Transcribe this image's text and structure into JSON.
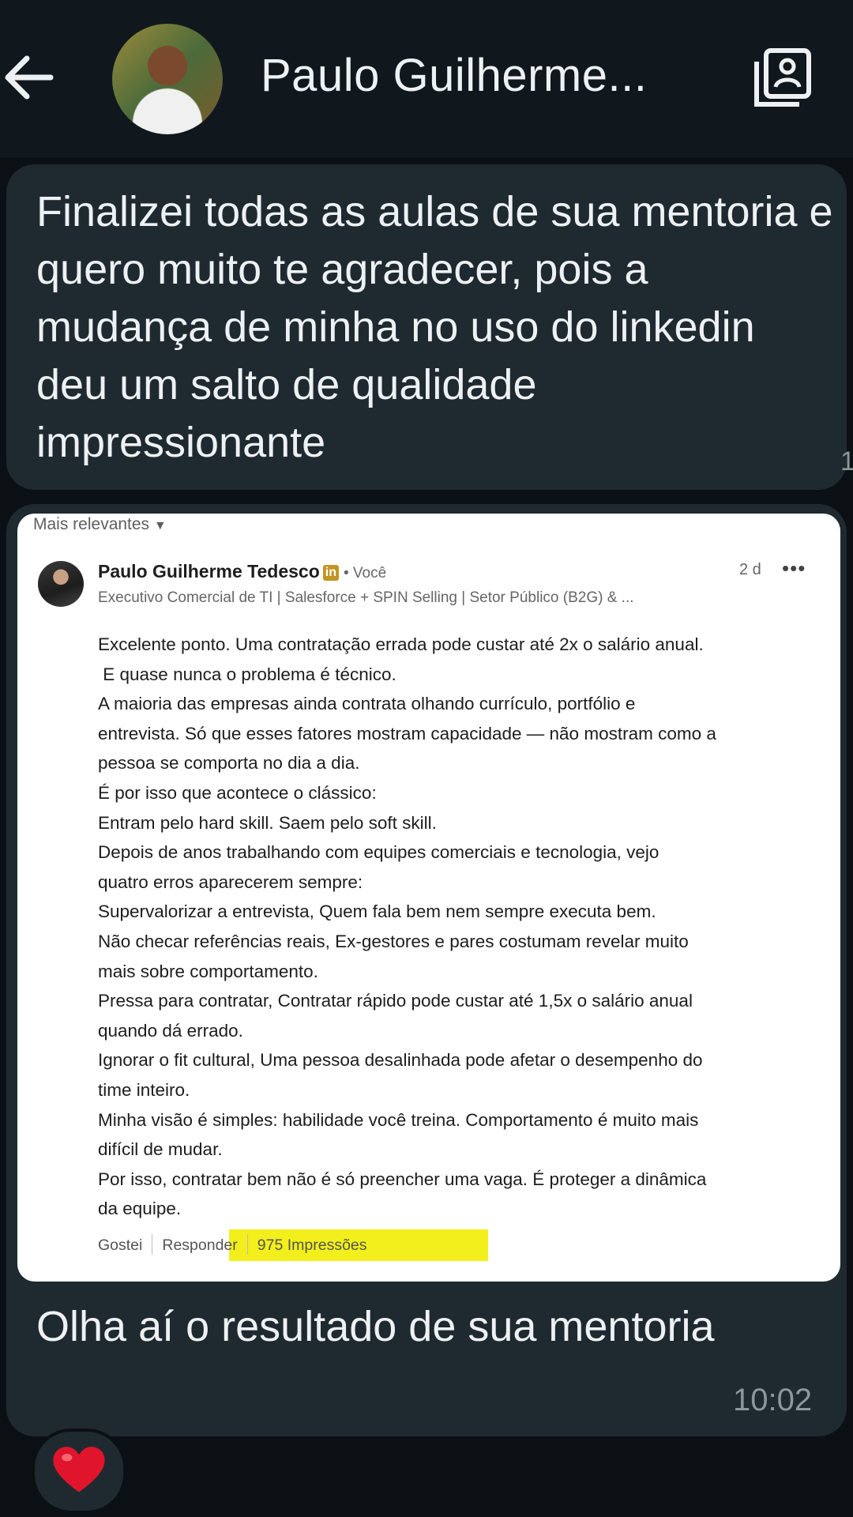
{
  "header": {
    "contact_name": "Paulo Guilherme...",
    "icons": {
      "back": "back-arrow-icon",
      "contact_card": "contact-card-icon"
    }
  },
  "messages": [
    {
      "text": "Finalizei todas as aulas de sua mentoria e quero muito te agradecer, pois a mudança de minha no uso do linkedin deu um salto de qualidade impressionante",
      "edge_digit": "1"
    }
  ],
  "linkedin_comment": {
    "sort_label": "Mais relevantes",
    "author": "Paulo Guilherme Tedesco",
    "badge": "in",
    "you_label": "• Você",
    "time": "2 d",
    "more": "•••",
    "headline": "Executivo Comercial de TI | Salesforce + SPIN Selling | Setor Público (B2G) & ...",
    "body_lines": [
      "Excelente ponto. Uma contratação errada pode custar até 2x o salário anual.",
      " E quase nunca o problema é técnico.",
      "A maioria das empresas ainda contrata olhando currículo, portfólio e",
      "entrevista. Só que esses fatores mostram capacidade — não mostram como a",
      "pessoa se comporta no dia a dia.",
      "É por isso que acontece o clássico:",
      "Entram pelo hard skill. Saem pelo soft skill.",
      "Depois de anos trabalhando com equipes comerciais e tecnologia, vejo",
      "quatro erros aparecerem sempre:",
      "Supervalorizar a entrevista, Quem fala bem nem sempre executa bem.",
      "Não checar referências reais, Ex-gestores e pares costumam revelar muito",
      "mais sobre comportamento.",
      "Pressa para contratar, Contratar rápido pode custar até 1,5x o salário anual",
      "quando dá errado.",
      "Ignorar o fit cultural, Uma pessoa desalinhada pode afetar o desempenho do",
      "time inteiro.",
      "Minha visão é simples: habilidade você treina. Comportamento é muito mais",
      "difícil de mudar.",
      "Por isso, contratar bem não é só preencher uma vaga. É proteger a dinâmica",
      "da equipe."
    ],
    "actions": {
      "like": "Gostei",
      "reply": "Responder",
      "impressions": "975 Impressões"
    },
    "highlight_color": "#f2ef1c"
  },
  "caption": "Olha aí o resultado de sua mentoria",
  "timestamp": "10:02",
  "reaction": {
    "icon": "heart-icon",
    "color": "#e0152b"
  },
  "colors": {
    "background": "#0b1014",
    "header": "#11181d",
    "bubble": "#1f2a30",
    "text": "#eef1f3",
    "meta": "#8b979e"
  }
}
